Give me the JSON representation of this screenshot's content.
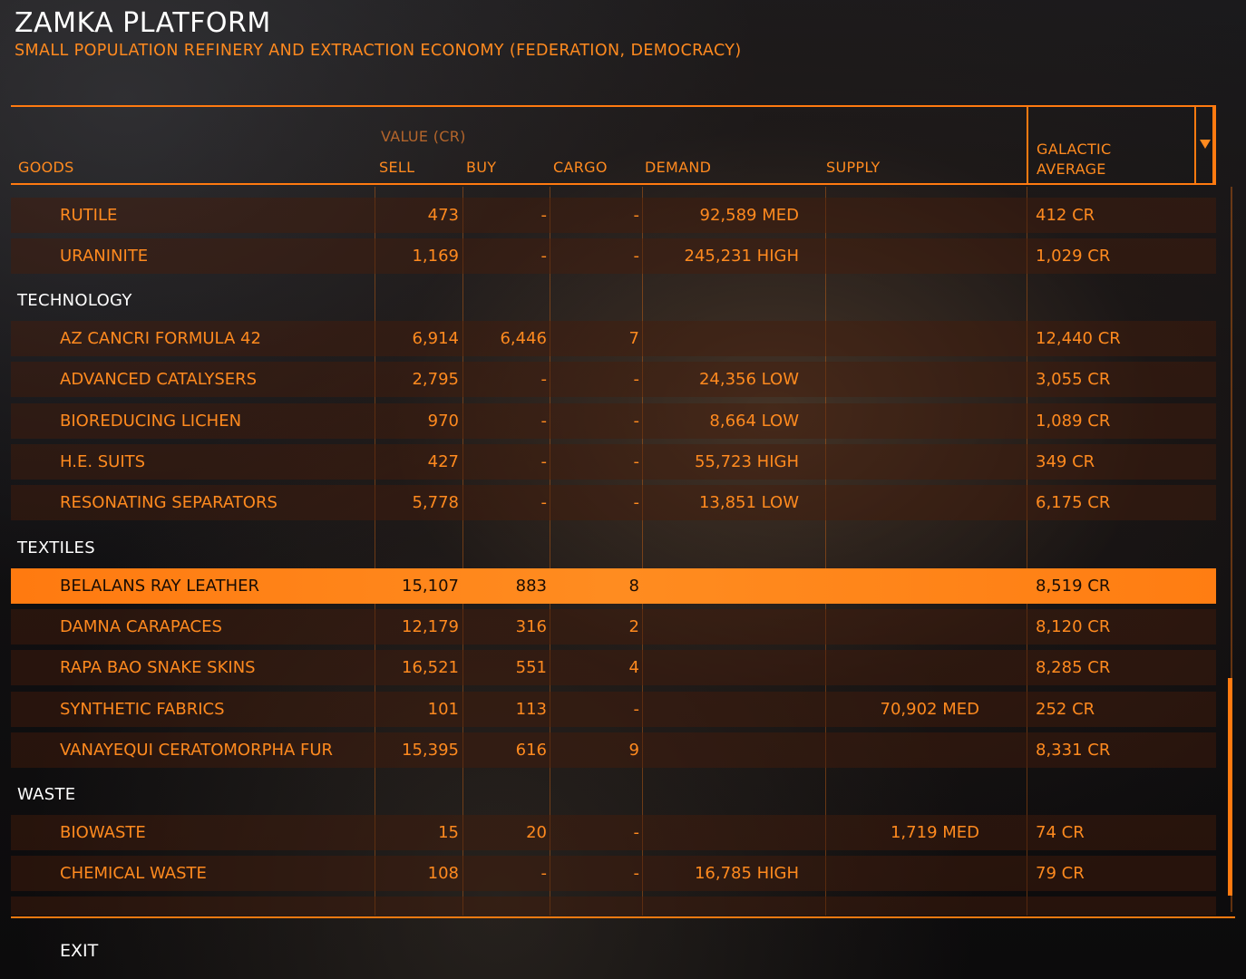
{
  "station": {
    "name": "ZAMKA PLATFORM",
    "description": "SMALL POPULATION REFINERY AND EXTRACTION ECONOMY (FEDERATION, DEMOCRACY)"
  },
  "header": {
    "goods": "GOODS",
    "value_group": "VALUE (CR)",
    "sell": "SELL",
    "buy": "BUY",
    "cargo": "CARGO",
    "demand": "DEMAND",
    "supply": "SUPPLY",
    "galactic_average_line1": "GALACTIC",
    "galactic_average_line2": "AVERAGE"
  },
  "rows": [
    {
      "name": "RUTILE",
      "sell": "473",
      "buy": "-",
      "cargo": "-",
      "demand": "92,589 MED",
      "supply": "",
      "avg": "412 CR"
    },
    {
      "name": "URANINITE",
      "sell": "1,169",
      "buy": "-",
      "cargo": "-",
      "demand": "245,231 HIGH",
      "supply": "",
      "avg": "1,029 CR"
    }
  ],
  "categories": [
    "TECHNOLOGY",
    "TEXTILES",
    "WASTE"
  ],
  "technology_rows": [
    {
      "name": "AZ CANCRI FORMULA 42",
      "sell": "6,914",
      "buy": "6,446",
      "cargo": "7",
      "demand": "",
      "supply": "",
      "avg": "12,440 CR"
    },
    {
      "name": "ADVANCED CATALYSERS",
      "sell": "2,795",
      "buy": "-",
      "cargo": "-",
      "demand": "24,356 LOW",
      "supply": "",
      "avg": "3,055 CR"
    },
    {
      "name": "BIOREDUCING LICHEN",
      "sell": "970",
      "buy": "-",
      "cargo": "-",
      "demand": "8,664 LOW",
      "supply": "",
      "avg": "1,089 CR"
    },
    {
      "name": "H.E. SUITS",
      "sell": "427",
      "buy": "-",
      "cargo": "-",
      "demand": "55,723 HIGH",
      "supply": "",
      "avg": "349 CR"
    },
    {
      "name": "RESONATING SEPARATORS",
      "sell": "5,778",
      "buy": "-",
      "cargo": "-",
      "demand": "13,851 LOW",
      "supply": "",
      "avg": "6,175 CR"
    }
  ],
  "textiles_rows": [
    {
      "name": "BELALANS RAY LEATHER",
      "sell": "15,107",
      "buy": "883",
      "cargo": "8",
      "demand": "",
      "supply": "",
      "avg": "8,519 CR",
      "selected": true
    },
    {
      "name": "DAMNA CARAPACES",
      "sell": "12,179",
      "buy": "316",
      "cargo": "2",
      "demand": "",
      "supply": "",
      "avg": "8,120 CR"
    },
    {
      "name": "RAPA BAO SNAKE SKINS",
      "sell": "16,521",
      "buy": "551",
      "cargo": "4",
      "demand": "",
      "supply": "",
      "avg": "8,285 CR"
    },
    {
      "name": "SYNTHETIC FABRICS",
      "sell": "101",
      "buy": "113",
      "cargo": "-",
      "demand": "",
      "supply": "70,902 MED",
      "avg": "252 CR"
    },
    {
      "name": "VANAYEQUI CERATOMORPHA FUR",
      "sell": "15,395",
      "buy": "616",
      "cargo": "9",
      "demand": "",
      "supply": "",
      "avg": "8,331 CR"
    }
  ],
  "waste_rows": [
    {
      "name": "BIOWASTE",
      "sell": "15",
      "buy": "20",
      "cargo": "-",
      "demand": "",
      "supply": "1,719 MED",
      "avg": "74 CR"
    },
    {
      "name": "CHEMICAL WASTE",
      "sell": "108",
      "buy": "-",
      "cargo": "-",
      "demand": "16,785 HIGH",
      "supply": "",
      "avg": "79 CR"
    }
  ],
  "footer": {
    "exit": "EXIT"
  }
}
